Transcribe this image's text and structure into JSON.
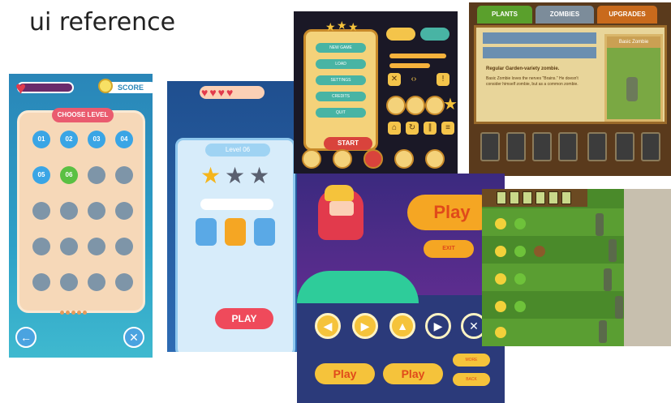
{
  "heading": "ui reference",
  "panel_a": {
    "score_label": "SCORE",
    "board_title": "CHOOSE LEVEL",
    "levels": [
      "01",
      "02",
      "03",
      "04",
      "05",
      "06"
    ],
    "colors": {
      "open": "#3aa5e5",
      "completed": "#5ac043",
      "locked": "#7e95a8",
      "accent": "#ea5b6f"
    }
  },
  "panel_b": {
    "card_title": "Level 06",
    "play_label": "PLAY",
    "colors": {
      "play": "#ef4a5b",
      "star_on": "#f5b51c",
      "star_off": "#5a6070"
    }
  },
  "panel_c": {
    "menu_items": [
      "NEW GAME",
      "LOAD",
      "SETTINGS",
      "CREDITS",
      "QUIT"
    ],
    "start_label": "START",
    "colors": {
      "menu_item": "#48b4a4",
      "start": "#d9433c",
      "frame": "#f4d27a"
    }
  },
  "panel_d": {
    "tabs": [
      "PLANTS",
      "ZOMBIES",
      "UPGRADES"
    ],
    "portrait_label": "Basic Zombie",
    "desc_title": "Regular Garden-variety zombie.",
    "desc_text": "Basic Zombie loves the nerves \"Brains.\" He doesn't consider himself zombie, but as a common zombie.",
    "colors": {
      "tab_active": "#5aa02c",
      "tab_mid": "#7c8c9a",
      "tab_right": "#c96a1c"
    }
  },
  "panel_e": {
    "play_big": "Play",
    "exit_label": "EXIT",
    "play_small_1": "Play",
    "play_small_2": "Play",
    "pill_1": "MORE",
    "pill_2": "BACK",
    "colors": {
      "button": "#f5c33b",
      "text": "#e04a1a",
      "bg": "#2b3a7a"
    }
  },
  "panel_f": {
    "colors": {
      "lawn_light": "#5a9e32",
      "lawn_dark": "#4a8a2a",
      "seedbar": "#6b4a22"
    }
  }
}
